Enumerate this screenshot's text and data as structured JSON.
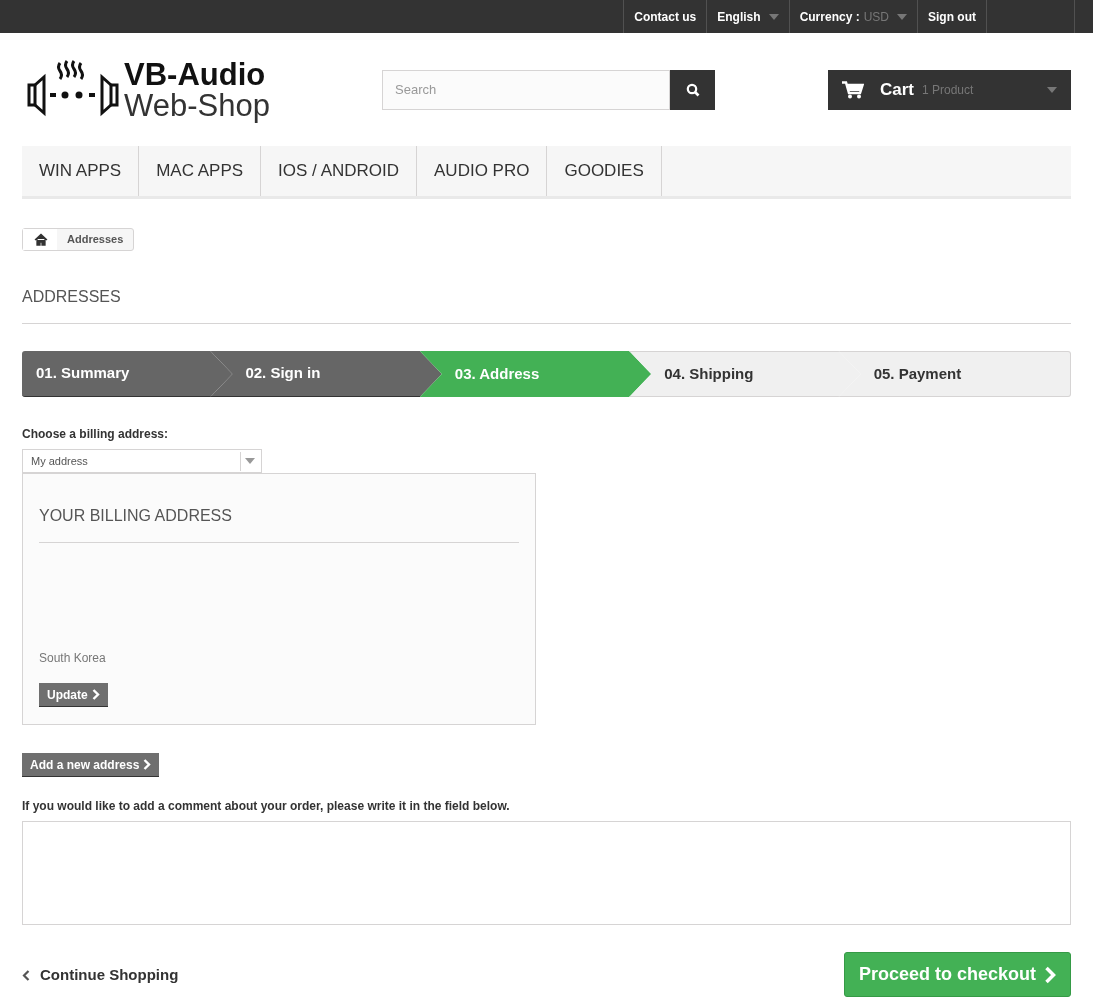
{
  "top_bar": {
    "links": [
      {
        "label": "Contact us",
        "kind": "link"
      },
      {
        "label": "English",
        "kind": "dropdown"
      },
      {
        "label": "Currency :",
        "value": "USD",
        "kind": "dropdown"
      },
      {
        "label": "Sign out",
        "kind": "link"
      }
    ]
  },
  "logo": {
    "line_1": "VB-Audio",
    "line_2": "Web-Shop"
  },
  "search": {
    "placeholder": "Search"
  },
  "cart": {
    "label": "Cart",
    "count": "1 Product"
  },
  "nav": [
    "WIN APPS",
    "MAC APPS",
    "IOS / ANDROID",
    "AUDIO PRO",
    "GOODIES"
  ],
  "breadcrumb": {
    "current": "Addresses"
  },
  "page_title": "ADDRESSES",
  "steps": [
    {
      "label": "01. Summary",
      "done": true,
      "selected": false
    },
    {
      "label": "02. Sign in",
      "done": true,
      "selected": false
    },
    {
      "label": "03. Address",
      "done": false,
      "selected": true
    },
    {
      "label": "04. Shipping",
      "done": false,
      "selected": false
    },
    {
      "label": "05. Payment",
      "done": false,
      "selected": false
    }
  ],
  "billing": {
    "label": "Choose a billing address:",
    "select_value": "My address",
    "heading": "YOUR BILLING ADDRESS",
    "country": "South Korea",
    "update_button": "Update"
  },
  "add_address_button": "Add a new address",
  "comment": {
    "label": "If you would like to add a comment about your order, please write it in the field below."
  },
  "continue_link": "Continue Shopping",
  "checkout_button": "Proceed to checkout"
}
